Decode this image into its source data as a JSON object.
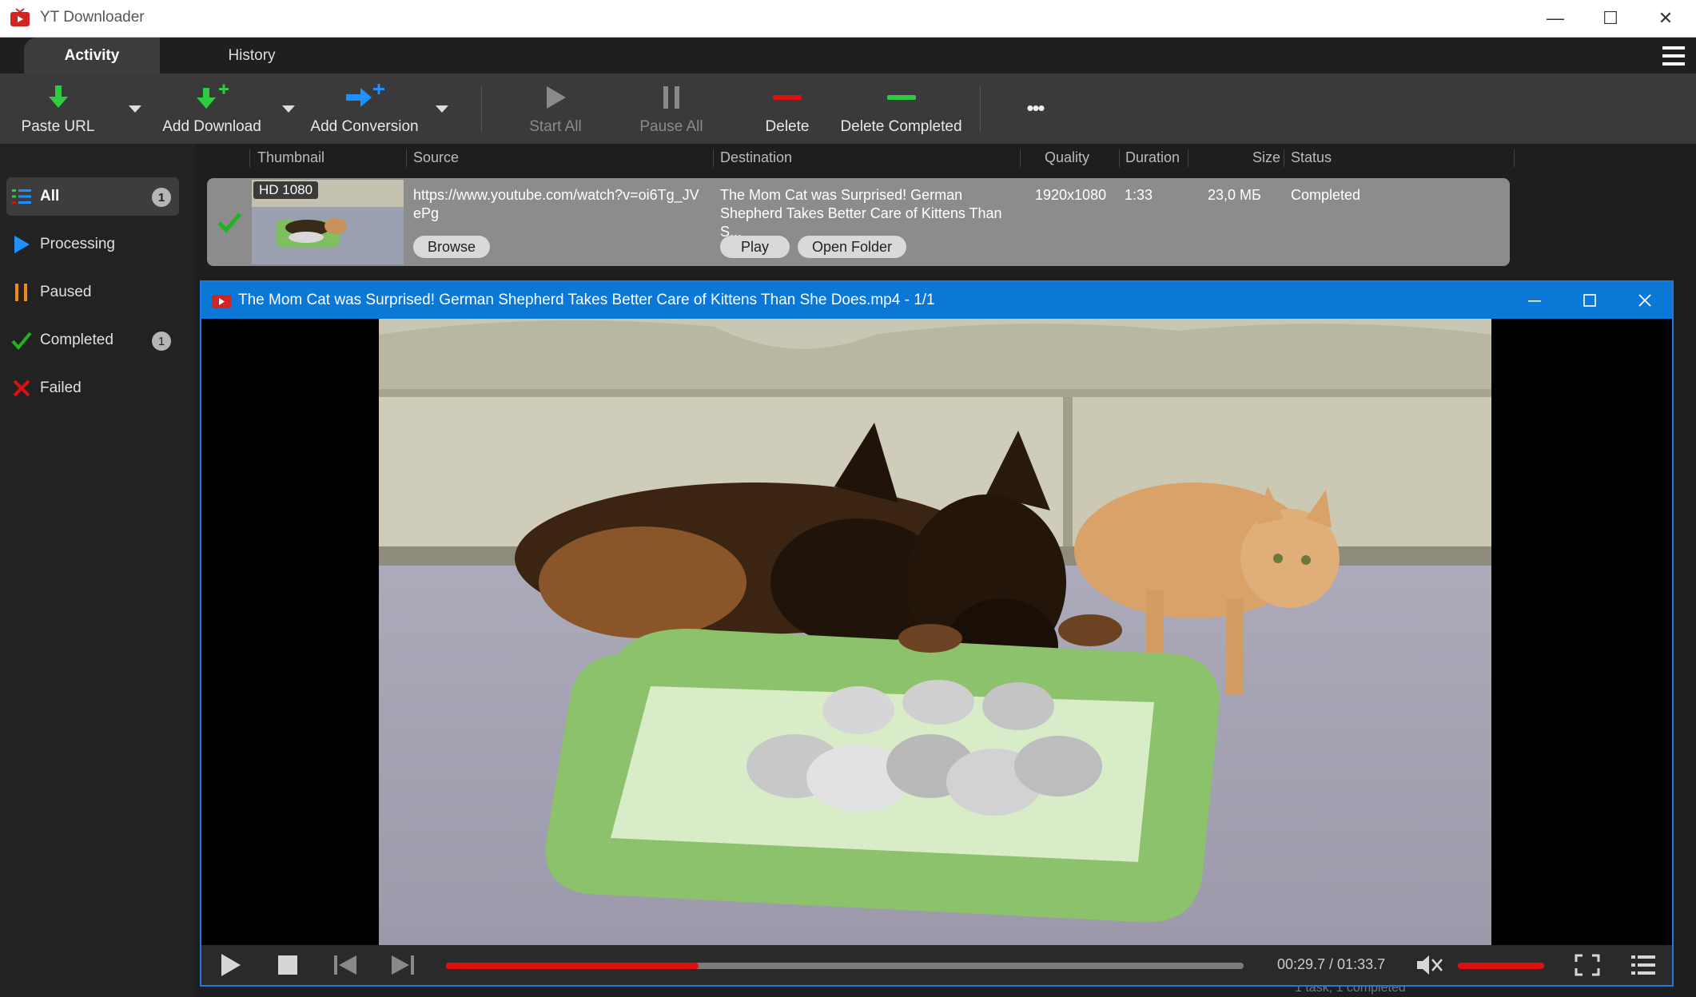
{
  "window": {
    "title": "YT Downloader",
    "minimize": "—",
    "maximize": "☐",
    "close": "✕"
  },
  "tabs": [
    {
      "label": "Activity"
    },
    {
      "label": "History"
    }
  ],
  "toolbar": {
    "paste_url": "Paste URL",
    "add_download": "Add Download",
    "add_conversion": "Add Conversion",
    "start_all": "Start All",
    "pause_all": "Pause All",
    "delete": "Delete",
    "delete_completed": "Delete Completed",
    "more": "•••"
  },
  "sidebar": {
    "items": [
      {
        "label": "All",
        "count": "1"
      },
      {
        "label": "Processing"
      },
      {
        "label": "Paused"
      },
      {
        "label": "Completed",
        "count": "1"
      },
      {
        "label": "Failed"
      }
    ]
  },
  "columns": {
    "thumbnail": "Thumbnail",
    "source": "Source",
    "destination": "Destination",
    "quality": "Quality",
    "duration": "Duration",
    "size": "Size",
    "status": "Status"
  },
  "download": {
    "thumb_badge": "HD 1080",
    "source_line1": "https://www.youtube.com/watch?v=oi6Tg_JV",
    "source_line2": "ePg",
    "dest_line1": "The Mom Cat was Surprised! German",
    "dest_line2": "Shepherd Takes Better Care of Kittens Than S...",
    "quality": "1920x1080",
    "duration": "1:33",
    "size": "23,0 МБ",
    "status": "Completed",
    "browse": "Browse",
    "play": "Play",
    "open_folder": "Open Folder"
  },
  "player": {
    "title": "The Mom Cat was Surprised! German Shepherd Takes Better Care of Kittens Than She Does.mp4 - 1/1",
    "time": "00:29.7 / 01:33.7",
    "progress": 0.317,
    "volume": 1.0
  },
  "footer": {
    "status": "1 task, 1 completed"
  },
  "colors": {
    "accent": "#0b78d8",
    "green": "#1fb31f",
    "red": "#e01010",
    "blue": "#1e90ff",
    "orange": "#f0891a"
  }
}
